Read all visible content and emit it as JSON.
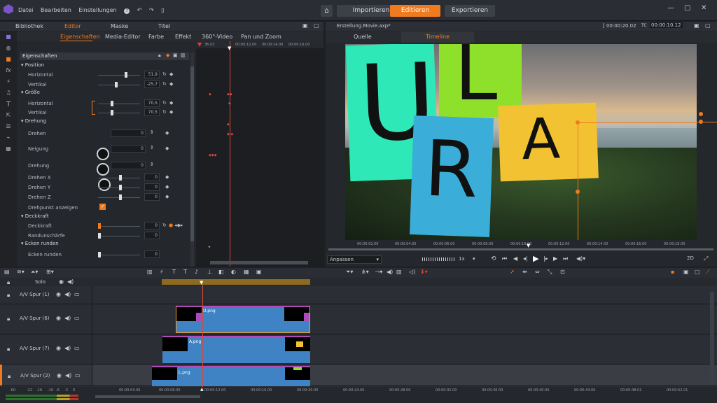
{
  "menu": {
    "items": [
      "Datei",
      "Bearbeiten",
      "Einstellungen"
    ]
  },
  "modes": {
    "import": "Importieren",
    "edit": "Editieren",
    "export": "Exportieren"
  },
  "leftpanel": {
    "tabs": [
      "Bibliothek",
      "Editor",
      "Maske",
      "Titel"
    ],
    "subtabs": [
      "Eigenschaften",
      "Media-Editor",
      "Farbe",
      "Effekt",
      "360°-Video",
      "Pan und Zoom"
    ],
    "header": "Eigenschaften",
    "timecode": "36.03",
    "ticks": [
      "00:00:12.00",
      "00:00:14.00",
      "00:00:16.00"
    ],
    "sections": {
      "position": "Position",
      "horizontal": "Horizontal",
      "vertikal": "Vertikal",
      "groesse": "Größe",
      "horizontal2": "Horizontal",
      "vertikal2": "Vertikal",
      "drehung": "Drehung",
      "drehen": "Drehen",
      "neigung": "Neigung",
      "drehung2": "Drehung",
      "drehenx": "Drehen X",
      "dreheny": "Drehen Y",
      "drehenz": "Drehen Z",
      "drehpunkt": "Drehpunkt anzeigen",
      "deckkraft": "Deckkraft",
      "deckkraft2": "Deckkraft",
      "randunschaerfe": "Randunschärfe",
      "eckenrunden": "Ecken runden",
      "eckenrunden2": "Ecken runden"
    },
    "values": {
      "h": "51,9",
      "v": "-25,7",
      "gh": "70,5",
      "gv": "70,5",
      "drehen": "0",
      "neigung": "0",
      "drehung": "0",
      "dx": "0",
      "dy": "0",
      "dz": "0",
      "deck": "0",
      "rand": "0",
      "ecken": "0"
    }
  },
  "preview": {
    "filename": "Erstellung.Movie.axp*",
    "tabs": [
      "Quelle",
      "Timeline"
    ],
    "tc_left": "[ 00:00:20.02",
    "tc_label": "TC",
    "tc_right": "00:00:10.12",
    "ticks": [
      "00:00:02.00",
      "00:00:04.00",
      "00:00:06.00",
      "00:00:08.00",
      "00:00:10.00",
      "00:00:12.00",
      "00:00:14.00",
      "00:00:16.00",
      "00:00:18.00"
    ],
    "fit": "Anpassen",
    "speed": "1x",
    "letters": [
      "U",
      "L",
      "R",
      "A"
    ],
    "colors": {
      "teal": "#2fe8b8",
      "lime": "#8fe02a",
      "blue": "#3aaed8",
      "yellow": "#f3c233",
      "accent": "#f07a1e"
    }
  },
  "timeline": {
    "solo": "Solo",
    "tracks": [
      "A/V Spur (1)",
      "A/V Spur (6)",
      "A/V Spur (7)",
      "A/V Spur (2)"
    ],
    "clips": [
      "U.png",
      "A.png",
      "L.png"
    ],
    "ticks": [
      "00:00:04.00",
      "00:00:08.00",
      "00:00:12.00",
      "00:00:16.00",
      "00:00:20.00",
      "00:00:24.00",
      "00:00:28.00",
      "00:00:32.00",
      "00:00:36.00",
      "00:00:40.00",
      "00:00:44.00",
      "00:00:48.01",
      "00:00:52.01"
    ],
    "meter": [
      "-60",
      "-22",
      "-16",
      "-10",
      "-6",
      "-3",
      "0"
    ]
  }
}
